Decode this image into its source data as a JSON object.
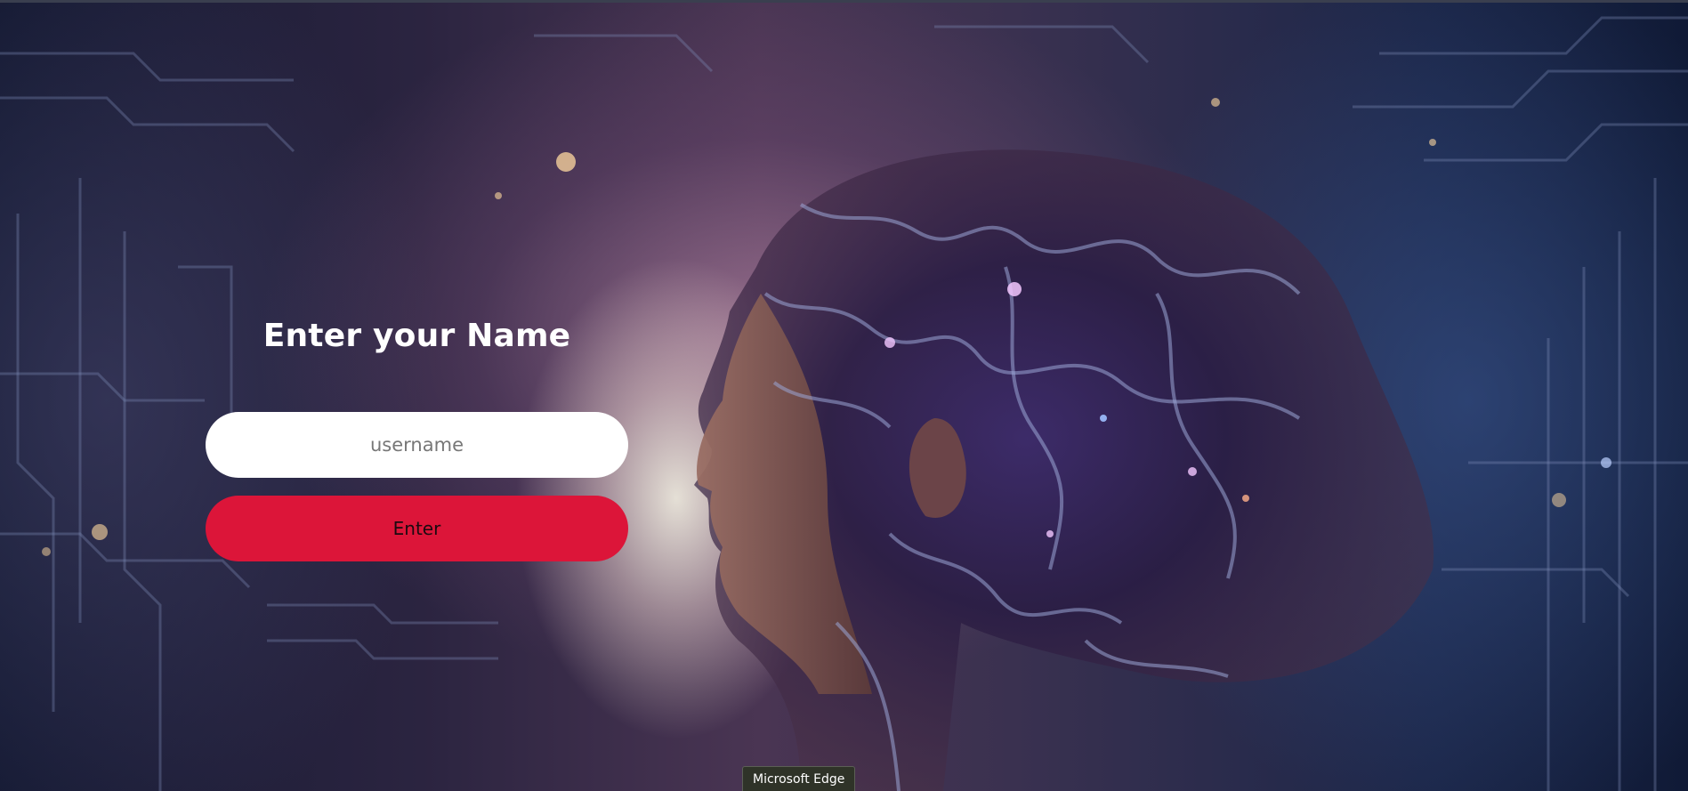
{
  "login": {
    "title": "Enter your Name",
    "username_placeholder": "username",
    "username_value": "",
    "submit_label": "Enter"
  },
  "taskbar_tooltip": {
    "text": "Microsoft Edge"
  },
  "colors": {
    "button_bg": "#dc1539",
    "input_bg": "#ffffff",
    "title_text": "#ffffff"
  }
}
